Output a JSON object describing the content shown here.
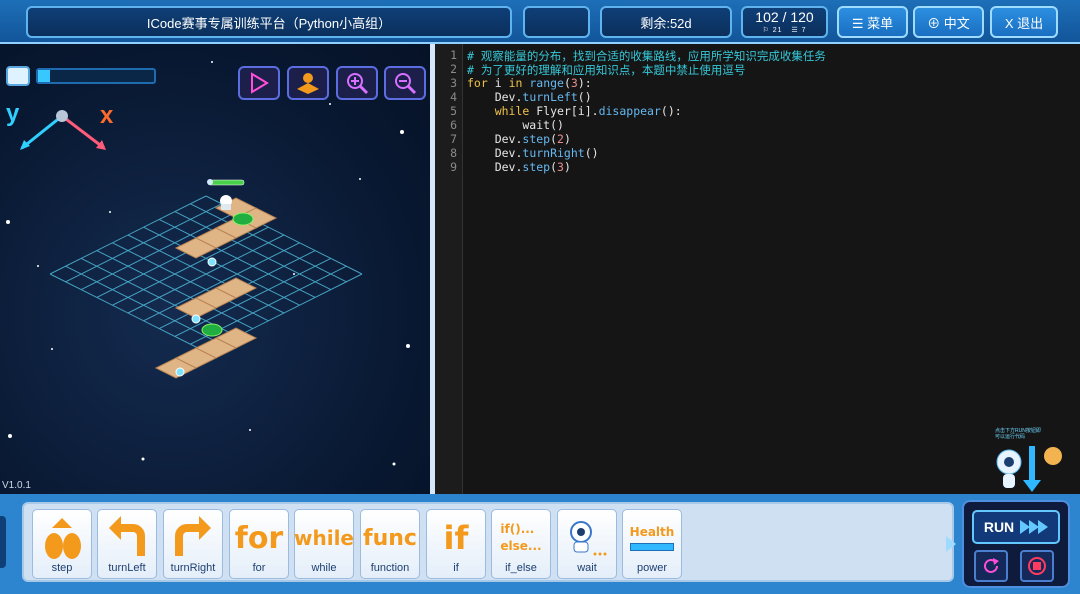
{
  "header": {
    "title": "ICode赛事专属训练平台（Python小高组）",
    "remaining": "剩余:52d",
    "score": "102 / 120",
    "score_sub_a": "⚐ 21",
    "score_sub_b": "☰ 7",
    "menu_label": "☰ 菜单",
    "lang_label": "⊕ 中文",
    "exit_label": "X 退出"
  },
  "scene": {
    "version": "V1.0.1",
    "axis_y": "y",
    "axis_x": "x",
    "energy_fraction": 0.1
  },
  "editor": {
    "lines": [
      {
        "n": "1",
        "text": "# 观察能量的分布，找到合适的收集路线，应用所学知识完成收集任务"
      },
      {
        "n": "2",
        "text": "# 为了更好的理解和应用知识点，本题中禁止使用逗号"
      },
      {
        "n": "3",
        "text": "for i in range(3):"
      },
      {
        "n": "4",
        "text": "    Dev.turnLeft()"
      },
      {
        "n": "5",
        "text": "    while Flyer[i].disappear():"
      },
      {
        "n": "6",
        "text": "        wait()"
      },
      {
        "n": "7",
        "text": "    Dev.step(2)"
      },
      {
        "n": "8",
        "text": "    Dev.turnRight()"
      },
      {
        "n": "9",
        "text": "    Dev.step(3)"
      }
    ]
  },
  "palette": {
    "tiles": [
      {
        "label": "step"
      },
      {
        "label": "turnLeft"
      },
      {
        "label": "turnRight"
      },
      {
        "label": "for",
        "art": "for"
      },
      {
        "label": "while",
        "art": "while"
      },
      {
        "label": "function",
        "art": "func"
      },
      {
        "label": "if",
        "art": "if"
      },
      {
        "label": "if_else",
        "art": "if()...\nelse..."
      },
      {
        "label": "wait"
      },
      {
        "label": "power",
        "art": "Health"
      }
    ],
    "run_label": "RUN"
  },
  "assistant": {
    "hint": "点击下方RUN按钮即可以运行代码"
  },
  "colors": {
    "accent": "#2d84cf",
    "comment": "#35c8d8",
    "keyword": "#f0c24a",
    "tile_text": "#f39a1c"
  }
}
